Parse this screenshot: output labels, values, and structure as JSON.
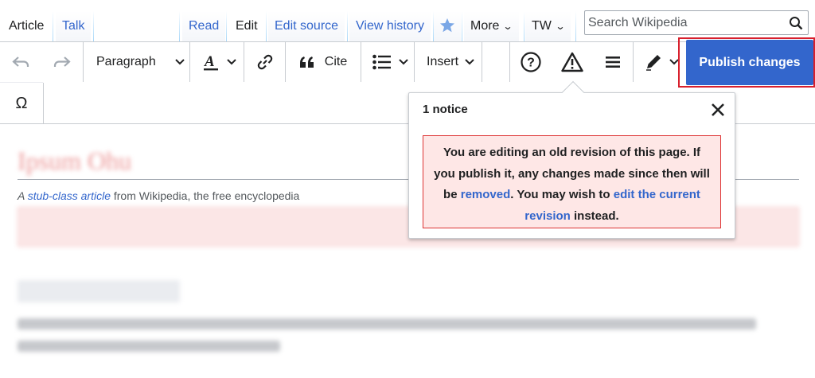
{
  "tabs": {
    "left": [
      {
        "label": "Article"
      },
      {
        "label": "Talk"
      }
    ],
    "right": [
      {
        "label": "Read"
      },
      {
        "label": "Edit"
      },
      {
        "label": "Edit source"
      },
      {
        "label": "View history"
      },
      {
        "label": "More"
      },
      {
        "label": "TW"
      }
    ]
  },
  "search": {
    "placeholder": "Search Wikipedia"
  },
  "toolbar": {
    "paragraph_label": "Paragraph",
    "cite_label": "Cite",
    "insert_label": "Insert",
    "special_char": "Ω",
    "publish_label": "Publish changes"
  },
  "notice": {
    "title": "1 notice",
    "text_1": "You are editing an old revision of this page. If you publish it, any changes made since then will be ",
    "link_1": "removed",
    "text_2": ". You may wish to ",
    "link_2": "edit the current revision",
    "text_3": " instead."
  },
  "article": {
    "title": "Ipsum Ohu",
    "tagline_prefix": "A ",
    "tagline_link": "stub-class article",
    "tagline_suffix": " from Wikipedia, the free encyclopedia"
  },
  "colors": {
    "link": "#3366cc",
    "publish_bg": "#3366cc",
    "highlight_border": "#d8202d",
    "notice_bg": "#fee7e6",
    "notice_border": "#dd3333",
    "watch_star": "#36c"
  }
}
